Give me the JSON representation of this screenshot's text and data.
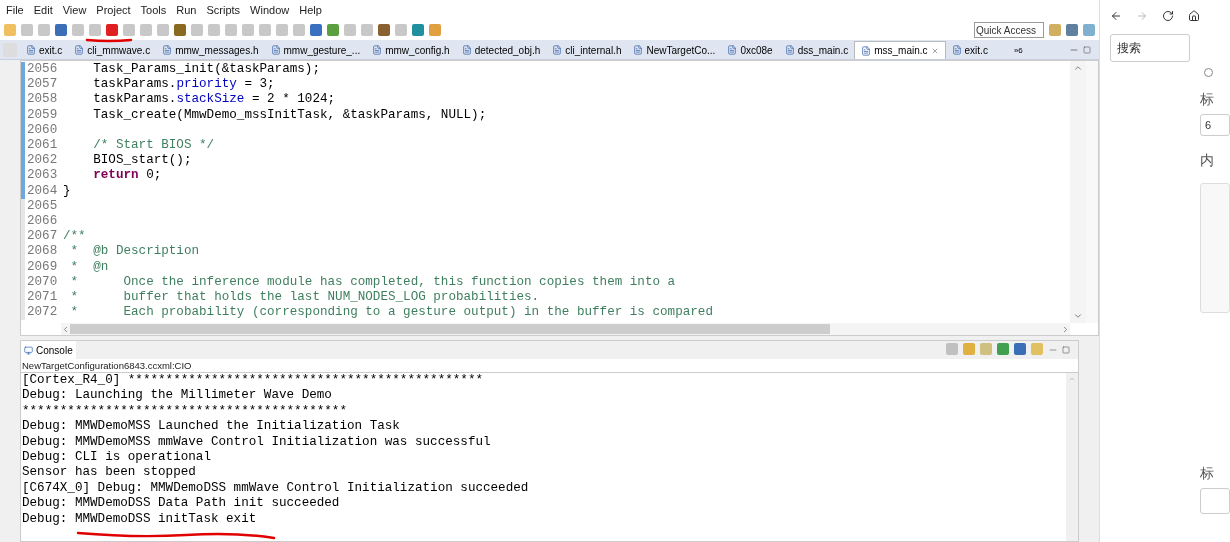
{
  "menu": [
    "File",
    "Edit",
    "View",
    "Project",
    "Tools",
    "Run",
    "Scripts",
    "Window",
    "Help"
  ],
  "quick_access": {
    "placeholder": "Quick Access"
  },
  "editor_tabs": [
    {
      "label": "exit.c",
      "selected": false
    },
    {
      "label": "cli_mmwave.c",
      "selected": false
    },
    {
      "label": "mmw_messages.h",
      "selected": false
    },
    {
      "label": "mmw_gesture_...",
      "selected": false
    },
    {
      "label": "mmw_config.h",
      "selected": false
    },
    {
      "label": "detected_obj.h",
      "selected": false
    },
    {
      "label": "cli_internal.h",
      "selected": false
    },
    {
      "label": "NewTargetCo...",
      "selected": false
    },
    {
      "label": "0xc08e",
      "selected": false
    },
    {
      "label": "dss_main.c",
      "selected": false
    },
    {
      "label": "mss_main.c",
      "selected": true
    },
    {
      "label": "exit.c",
      "selected": false
    }
  ],
  "overflow": "»6",
  "code_lines": [
    {
      "number": "2056",
      "changed": true,
      "segments": [
        {
          "kind": "plain",
          "text": "    Task_Params_init(&taskParams);"
        }
      ]
    },
    {
      "number": "2057",
      "changed": true,
      "segments": [
        {
          "kind": "plain",
          "text": "    taskParams."
        },
        {
          "kind": "field",
          "text": "priority"
        },
        {
          "kind": "plain",
          "text": " = 3;"
        }
      ]
    },
    {
      "number": "2058",
      "changed": true,
      "segments": [
        {
          "kind": "plain",
          "text": "    taskParams."
        },
        {
          "kind": "field",
          "text": "stackSize"
        },
        {
          "kind": "plain",
          "text": " = 2 * 1024;"
        }
      ]
    },
    {
      "number": "2059",
      "changed": true,
      "segments": [
        {
          "kind": "plain",
          "text": "    Task_create(MmwDemo_mssInitTask, &taskParams, NULL);"
        }
      ]
    },
    {
      "number": "2060",
      "changed": true
    },
    {
      "number": "2061",
      "changed": true,
      "segments": [
        {
          "kind": "comment",
          "text": "    /* Start BIOS */"
        }
      ]
    },
    {
      "number": "2062",
      "changed": true,
      "segments": [
        {
          "kind": "plain",
          "text": "    BIOS_start();"
        }
      ]
    },
    {
      "number": "2063",
      "changed": true,
      "segments": [
        {
          "kind": "keyword",
          "text": "    return"
        },
        {
          "kind": "plain",
          "text": " 0;"
        }
      ]
    },
    {
      "number": "2064",
      "changed": true,
      "segments": [
        {
          "kind": "plain",
          "text": "}"
        }
      ]
    },
    {
      "number": "2065",
      "changed": false
    },
    {
      "number": "2066",
      "changed": false
    },
    {
      "number": "2067",
      "changed": false,
      "segments": [
        {
          "kind": "comment",
          "text": "/**"
        }
      ]
    },
    {
      "number": "2068",
      "changed": false,
      "segments": [
        {
          "kind": "comment",
          "text": " *  @b Description"
        }
      ]
    },
    {
      "number": "2069",
      "changed": false,
      "segments": [
        {
          "kind": "comment",
          "text": " *  @n"
        }
      ]
    },
    {
      "number": "2070",
      "changed": false,
      "segments": [
        {
          "kind": "comment",
          "text": " *      Once the inference module has completed, this function copies them into a"
        }
      ]
    },
    {
      "number": "2071",
      "changed": false,
      "segments": [
        {
          "kind": "comment",
          "text": " *      buffer that holds the last NUM_NODES_LOG probabilities."
        }
      ]
    },
    {
      "number": "2072",
      "changed": false,
      "segments": [
        {
          "kind": "comment",
          "text": " *      Each probability (corresponding to a gesture output) in the buffer is compared"
        }
      ]
    }
  ],
  "console": {
    "tab": "Console",
    "title": "NewTargetConfiguration6843.ccxml:CIO",
    "lines": [
      "[Cortex_R4_0] ***********************************************",
      "Debug: Launching the Millimeter Wave Demo",
      "*******************************************",
      "Debug: MMWDemoMSS Launched the Initialization Task",
      "Debug: MMWDemoMSS mmWave Control Initialization was successful",
      "Debug: CLI is operational",
      "Sensor has been stopped",
      "[C674X_0] Debug: MMWDemoDSS mmWave Control Initialization succeeded",
      "Debug: MMWDemoDSS Data Path init succeeded",
      "Debug: MMWDemoDSS initTask exit"
    ]
  },
  "browser": {
    "search": {
      "placeholder": "搜索"
    },
    "radio": {
      "selected": false
    },
    "labels": [
      "标",
      "6",
      "内",
      "标"
    ]
  }
}
